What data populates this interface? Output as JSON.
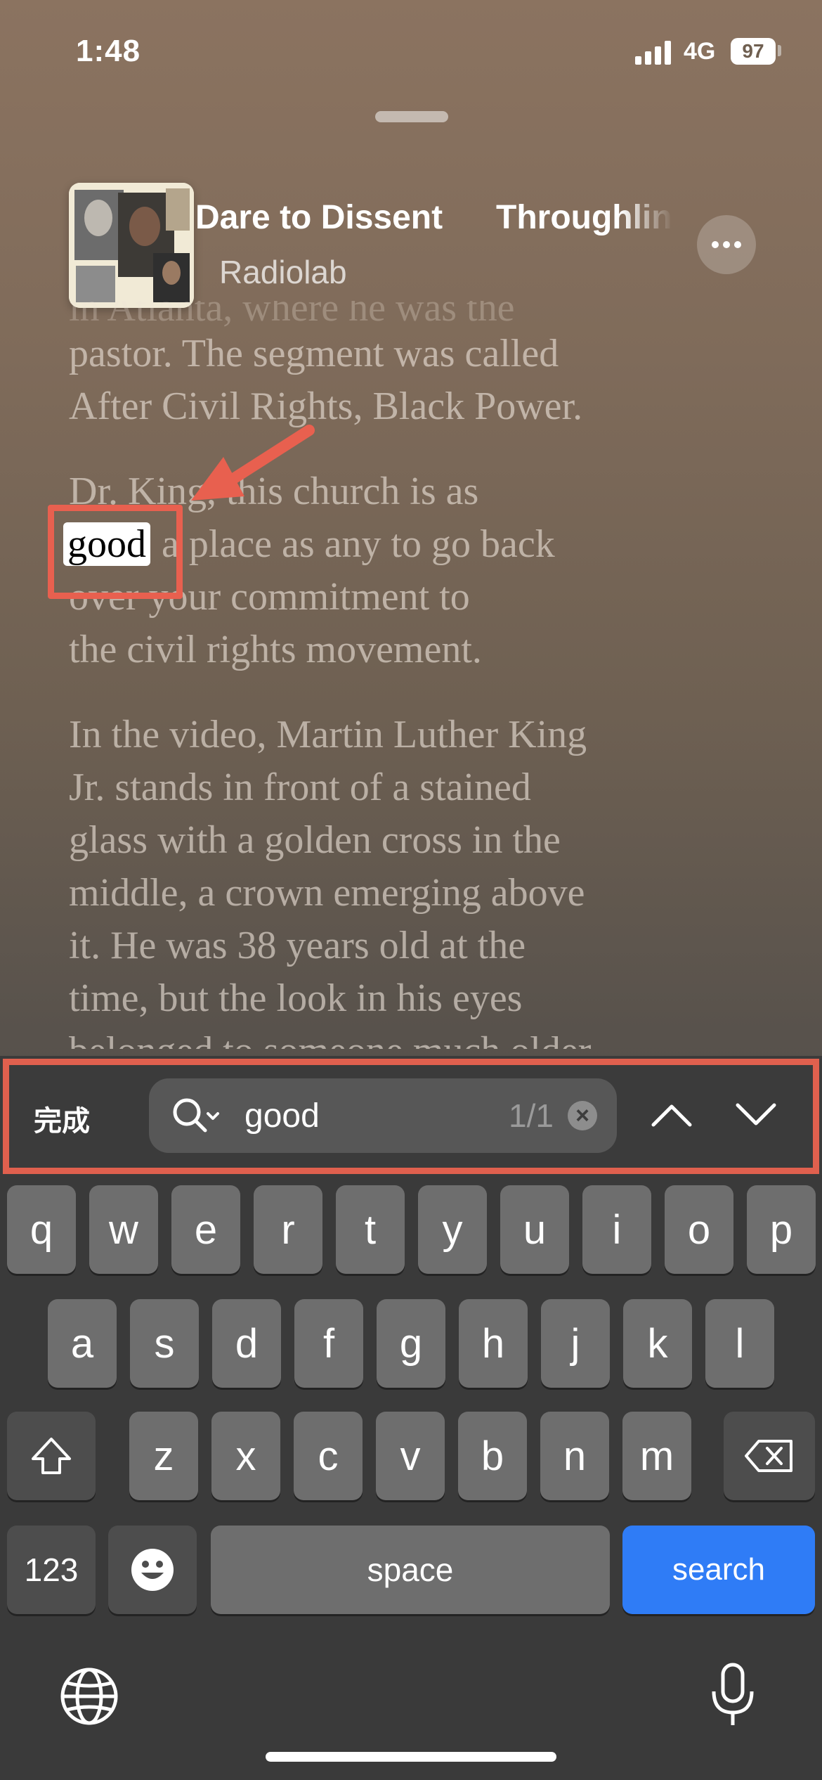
{
  "status_bar": {
    "time": "1:48",
    "network": "4G",
    "battery": "97"
  },
  "header": {
    "episode_title_1": "Dare to Dissent",
    "episode_title_2": "Throughlin",
    "podcast_name": "Radiolab"
  },
  "transcript": {
    "faded_line": "in Atlanta, where he was the",
    "para1": [
      "pastor. The segment was called",
      "After Civil Rights, Black Power."
    ],
    "para2_line1": "Dr. King, this church is as",
    "highlight": "good",
    "para2_line2_rest": " a place as any to go back",
    "para2_more": [
      "over your commitment to",
      "the civil rights movement."
    ],
    "para3": [
      "In the video, Martin Luther King",
      "Jr. stands in front of a stained",
      "glass with a golden cross in the",
      "middle, a crown emerging above",
      "it. He was 38 years old at the",
      "time, but the look in his eyes"
    ],
    "para3_cut": "belonged to someone much older."
  },
  "find_bar": {
    "done_label": "完成",
    "query": "good",
    "match_count": "1/1"
  },
  "keyboard": {
    "row1": [
      "q",
      "w",
      "e",
      "r",
      "t",
      "y",
      "u",
      "i",
      "o",
      "p"
    ],
    "row2": [
      "a",
      "s",
      "d",
      "f",
      "g",
      "h",
      "j",
      "k",
      "l"
    ],
    "row3": [
      "z",
      "x",
      "c",
      "v",
      "b",
      "n",
      "m"
    ],
    "numbers_label": "123",
    "space_label": "space",
    "search_label": "search"
  },
  "colors": {
    "accent_blue": "#2f7cf6",
    "annotation_red": "#e8604f",
    "highlight": "#ffffff"
  }
}
